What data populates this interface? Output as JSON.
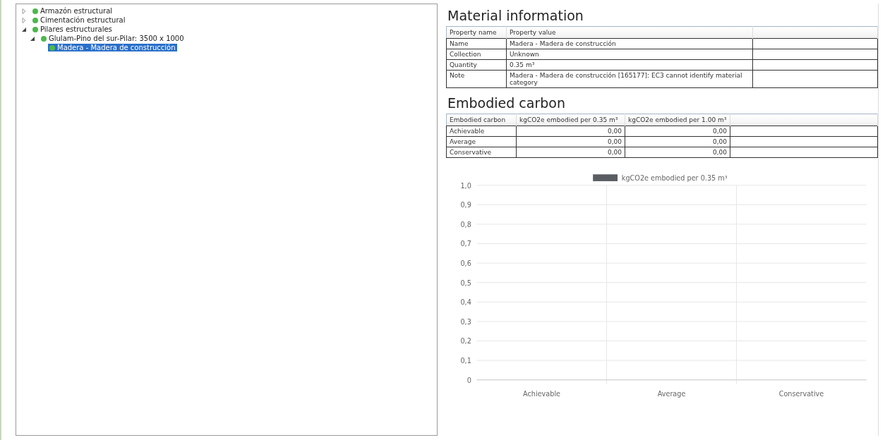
{
  "tree": [
    {
      "label": "Armazón estructural",
      "kind": "branch",
      "expanded": false,
      "selected": false
    },
    {
      "label": "Cimentación estructural",
      "kind": "branch",
      "expanded": false,
      "selected": false
    },
    {
      "label": "Pilares estructurales",
      "kind": "branch",
      "expanded": true,
      "selected": false,
      "children": [
        {
          "label": "Glulam-Pino del sur-Pilar: 3500 x 1000",
          "kind": "branch",
          "expanded": true,
          "selected": false,
          "children": [
            {
              "label": "Madera - Madera de construcción",
              "kind": "leaf",
              "selected": true
            }
          ]
        }
      ]
    }
  ],
  "material_information": {
    "title": "Material information",
    "columns": [
      "Property name",
      "Property value"
    ],
    "rows": [
      [
        "Name",
        "Madera - Madera de construcción"
      ],
      [
        "Collection",
        "Unknown"
      ],
      [
        "Quantity",
        "0.35 m³"
      ],
      [
        "Note",
        "Madera - Madera de construcción [165177]: EC3 cannot identify material category"
      ]
    ]
  },
  "embodied_carbon": {
    "title": "Embodied carbon",
    "columns": [
      "Embodied carbon",
      "kgCO2e embodied per 0.35 m³",
      "kgCO2e embodied per 1.00 m³"
    ],
    "rows": [
      [
        "Achievable",
        "0,00",
        "0,00"
      ],
      [
        "Average",
        "0,00",
        "0,00"
      ],
      [
        "Conservative",
        "0,00",
        "0,00"
      ]
    ],
    "chart_data": {
      "type": "bar",
      "categories": [
        "Achievable",
        "Average",
        "Conservative"
      ],
      "series": [
        {
          "name": "kgCO2e embodied per 0.35 m³",
          "color": "#5a5e63",
          "values": [
            0,
            0,
            0
          ]
        }
      ],
      "ylim": [
        0,
        1
      ],
      "grid": true,
      "yticks": [
        {
          "value": 0,
          "label": "0"
        },
        {
          "value": 0.1,
          "label": "0,1"
        },
        {
          "value": 0.2,
          "label": "0,2"
        },
        {
          "value": 0.3,
          "label": "0,3"
        },
        {
          "value": 0.4,
          "label": "0,4"
        },
        {
          "value": 0.5,
          "label": "0,5"
        },
        {
          "value": 0.6,
          "label": "0,6"
        },
        {
          "value": 0.7,
          "label": "0,7"
        },
        {
          "value": 0.8,
          "label": "0,8"
        },
        {
          "value": 0.9,
          "label": "0,9"
        },
        {
          "value": 1,
          "label": "1,0"
        }
      ]
    }
  }
}
